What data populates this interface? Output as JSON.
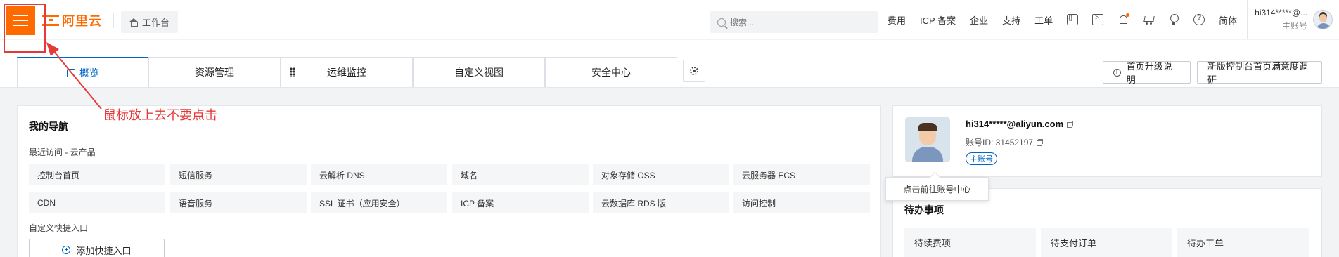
{
  "topbar": {
    "brand": "阿里云",
    "workbench_label": "工作台",
    "search_placeholder": "搜索...",
    "links": [
      "费用",
      "ICP 备案",
      "企业",
      "支持",
      "工单"
    ],
    "lang": "简体",
    "account_name": "hi314*****@...",
    "account_role": "主账号"
  },
  "tabs": [
    {
      "label": "概览"
    },
    {
      "label": "资源管理"
    },
    {
      "label": "运维监控"
    },
    {
      "label": "自定义视图"
    },
    {
      "label": "安全中心"
    }
  ],
  "header_buttons": {
    "upgrade_note": "首页升级说明",
    "survey": "新版控制台首页满意度调研"
  },
  "nav_card": {
    "title": "我的导航",
    "recent_label": "最近访问 - 云产品",
    "items": [
      "控制台首页",
      "短信服务",
      "云解析 DNS",
      "域名",
      "对象存储 OSS",
      "云服务器 ECS",
      "CDN",
      "语音服务",
      "SSL 证书（应用安全）",
      "ICP 备案",
      "云数据库 RDS 版",
      "访问控制"
    ],
    "custom_label": "自定义快捷入口",
    "add_button": "添加快捷入口"
  },
  "profile": {
    "email": "hi314*****@aliyun.com",
    "account_id": "账号ID: 31452197",
    "badge": "主账号",
    "tooltip": "点击前往账号中心"
  },
  "todo": {
    "title": "待办事项",
    "items": [
      "待续费项",
      "待支付订单",
      "待办工单"
    ]
  },
  "annotation": {
    "text": "鼠标放上去不要点击",
    "color": "#e63a3a"
  },
  "colors": {
    "brand": "#ff6a00",
    "accent": "#0064c8"
  }
}
